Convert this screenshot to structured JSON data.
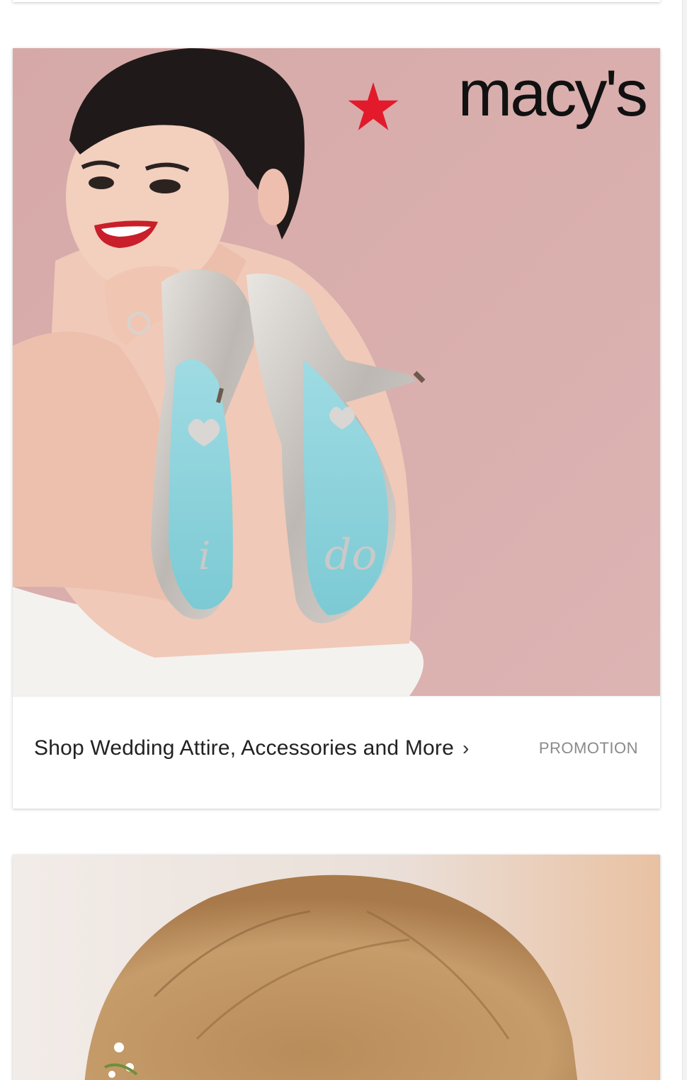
{
  "promo_card": {
    "brand": "macy's",
    "title": "Shop Wedding Attire, Accessories and More",
    "chevron": "›",
    "tag": "PROMOTION",
    "image": "Bride holding silver heels with light-blue soles over her shoulder"
  },
  "next_card": {
    "image": "Bride's hair updo with small white flowers"
  },
  "colors": {
    "hero_bg": "#d8acab",
    "sole_blue": "#8fd3dc",
    "macys_red": "#e21a2c",
    "tag_gray": "#8a8a8a"
  }
}
